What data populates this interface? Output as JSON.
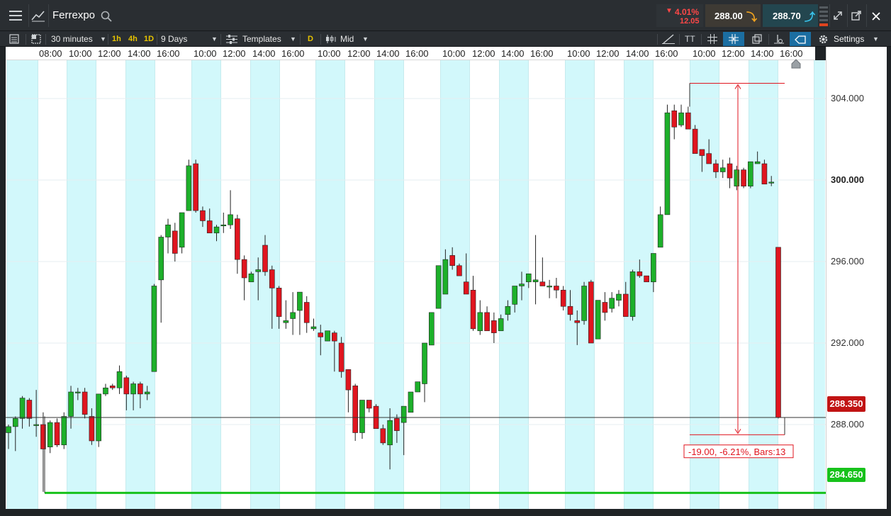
{
  "instrument": {
    "name": "Ferrexpo"
  },
  "quote": {
    "change_pct": "4.01%",
    "change_abs": "12.05",
    "sell": "288.00",
    "buy": "288.70"
  },
  "toolbar": {
    "interval": "30 minutes",
    "tf_1h": "1h",
    "tf_4h": "4h",
    "tf_1d": "1D",
    "range": "9 Days",
    "templates": "Templates",
    "d_badge": "D",
    "price_type": "Mid",
    "text_tool": "TT",
    "settings": "Settings"
  },
  "colors": {
    "up": "#1db02a",
    "down": "#e0151f",
    "band": "#d2f8fb",
    "level_line": "#17c21b",
    "current_tag": "#c11414"
  },
  "time_axis": {
    "labels": [
      "08:00",
      "10:00",
      "12:00",
      "14:00",
      "16:00",
      "10:00",
      "12:00",
      "14:00",
      "16:00",
      "10:00",
      "12:00",
      "14:00",
      "16:00",
      "10:00",
      "12:00",
      "14:00",
      "16:00",
      "10:00",
      "12:00",
      "14:00",
      "16:00",
      "10:00",
      "12:00",
      "14:00",
      "16:00"
    ]
  },
  "price_axis": {
    "labels": [
      "304.000",
      "300.000",
      "296.000",
      "292.000",
      "288.000"
    ],
    "current_price": "288.350",
    "level_price": "284.650"
  },
  "measure": {
    "label": "-19.00, -6.21%, Bars:13"
  },
  "chart_data": {
    "type": "candlestick",
    "title": "Ferrexpo",
    "interval": "30 minutes",
    "range": "9 Days",
    "ylim": [
      283.5,
      306.8
    ],
    "candles": [
      [
        287.6,
        288.0,
        286.8,
        287.9
      ],
      [
        287.9,
        288.4,
        286.7,
        288.3
      ],
      [
        288.3,
        289.4,
        287.8,
        289.3
      ],
      [
        289.2,
        289.3,
        287.9,
        288.3
      ],
      [
        288.0,
        289.7,
        287.4,
        288.0
      ],
      [
        288.0,
        288.6,
        284.7,
        286.8
      ],
      [
        286.9,
        288.2,
        286.6,
        288.1
      ],
      [
        288.1,
        288.3,
        286.9,
        287.0
      ],
      [
        287.0,
        288.6,
        286.8,
        288.4
      ],
      [
        288.4,
        289.9,
        287.8,
        289.6
      ],
      [
        289.6,
        289.8,
        289.2,
        289.6
      ],
      [
        289.6,
        289.8,
        288.3,
        288.5
      ],
      [
        288.4,
        288.8,
        287.0,
        287.2
      ],
      [
        287.2,
        289.5,
        286.9,
        289.5
      ],
      [
        289.5,
        290.0,
        289.4,
        289.8
      ],
      [
        289.9,
        290.0,
        289.7,
        289.8
      ],
      [
        289.8,
        290.9,
        289.5,
        290.6
      ],
      [
        290.3,
        290.4,
        288.7,
        289.5
      ],
      [
        289.5,
        290.1,
        288.7,
        290.0
      ],
      [
        290.0,
        290.1,
        288.8,
        289.5
      ],
      [
        289.5,
        289.9,
        289.2,
        289.6
      ],
      [
        290.6,
        294.9,
        290.6,
        294.8
      ],
      [
        295.1,
        297.3,
        293.0,
        297.2
      ],
      [
        297.2,
        298.1,
        296.4,
        297.8
      ],
      [
        297.5,
        297.9,
        296.0,
        296.4
      ],
      [
        296.7,
        298.4,
        296.4,
        298.4
      ],
      [
        298.5,
        301.0,
        298.5,
        300.7
      ],
      [
        300.8,
        301.0,
        298.4,
        298.5
      ],
      [
        298.5,
        298.7,
        297.7,
        298.0
      ],
      [
        298.0,
        298.6,
        297.5,
        297.4
      ],
      [
        297.4,
        297.8,
        297.0,
        297.7
      ],
      [
        297.8,
        298.4,
        297.4,
        297.8
      ],
      [
        297.8,
        299.5,
        297.6,
        298.3
      ],
      [
        298.1,
        298.3,
        295.4,
        296.1
      ],
      [
        296.1,
        296.3,
        294.1,
        295.2
      ],
      [
        295.0,
        295.5,
        295.0,
        295.4
      ],
      [
        295.5,
        296.2,
        294.1,
        295.6
      ],
      [
        296.8,
        297.3,
        295.3,
        295.5
      ],
      [
        295.6,
        295.8,
        292.7,
        294.7
      ],
      [
        294.7,
        294.8,
        292.7,
        293.3
      ],
      [
        293.0,
        294.1,
        292.7,
        293.1
      ],
      [
        293.2,
        294.5,
        292.4,
        293.5
      ],
      [
        293.6,
        294.5,
        292.4,
        294.5
      ],
      [
        294.0,
        294.3,
        292.5,
        293.0
      ],
      [
        292.7,
        293.2,
        292.6,
        292.8
      ],
      [
        292.5,
        292.9,
        291.4,
        292.3
      ],
      [
        292.1,
        292.6,
        292.1,
        292.6
      ],
      [
        292.5,
        292.6,
        290.6,
        292.1
      ],
      [
        292.0,
        292.3,
        290.3,
        290.6
      ],
      [
        290.7,
        290.7,
        288.6,
        289.7
      ],
      [
        289.9,
        290.0,
        287.2,
        287.6
      ],
      [
        287.6,
        287.8,
        287.3,
        289.2
      ],
      [
        289.2,
        289.2,
        288.6,
        288.8
      ],
      [
        288.9,
        289.0,
        287.9,
        287.8
      ],
      [
        287.8,
        288.0,
        287.0,
        287.1
      ],
      [
        287.0,
        288.8,
        285.8,
        288.2
      ],
      [
        288.3,
        288.5,
        287.1,
        287.7
      ],
      [
        288.1,
        288.8,
        286.5,
        288.9
      ],
      [
        288.6,
        289.6,
        288.6,
        289.6
      ],
      [
        289.6,
        290.0,
        290.0,
        290.1
      ],
      [
        290.0,
        292.0,
        289.1,
        292.0
      ],
      [
        291.9,
        293.5,
        291.9,
        293.5
      ],
      [
        293.7,
        294.6,
        293.7,
        295.8
      ],
      [
        294.4,
        296.6,
        294.4,
        296.1
      ],
      [
        296.3,
        296.7,
        295.6,
        295.8
      ],
      [
        295.8,
        295.9,
        295.6,
        295.3
      ],
      [
        295.0,
        296.4,
        294.5,
        294.4
      ],
      [
        294.6,
        295.3,
        292.6,
        292.7
      ],
      [
        292.6,
        294.1,
        292.4,
        293.5
      ],
      [
        293.5,
        293.8,
        292.6,
        292.6
      ],
      [
        293.1,
        293.5,
        292.0,
        292.5
      ],
      [
        292.6,
        293.4,
        292.6,
        293.2
      ],
      [
        293.4,
        294.1,
        293.1,
        293.8
      ],
      [
        293.9,
        294.2,
        293.5,
        294.8
      ],
      [
        294.8,
        295.5,
        294.1,
        294.9
      ],
      [
        295.0,
        295.2,
        294.7,
        295.4
      ],
      [
        295.0,
        297.3,
        293.9,
        295.1
      ],
      [
        295.0,
        296.2,
        294.8,
        294.8
      ],
      [
        294.8,
        295.1,
        294.2,
        294.8
      ],
      [
        294.8,
        295.2,
        294.2,
        294.6
      ],
      [
        294.6,
        294.8,
        293.6,
        293.8
      ],
      [
        293.8,
        294.6,
        293.1,
        293.4
      ],
      [
        293.1,
        293.6,
        291.9,
        293.0
      ],
      [
        293.1,
        295.0,
        292.9,
        294.8
      ],
      [
        295.0,
        295.1,
        292.1,
        292.0
      ],
      [
        292.2,
        294.1,
        292.2,
        294.1
      ],
      [
        294.0,
        294.5,
        293.1,
        293.5
      ],
      [
        293.7,
        294.5,
        293.5,
        294.2
      ],
      [
        294.1,
        294.6,
        293.8,
        294.4
      ],
      [
        294.4,
        295.0,
        293.7,
        293.3
      ],
      [
        293.3,
        295.6,
        293.1,
        295.5
      ],
      [
        295.5,
        296.1,
        295.2,
        295.3
      ],
      [
        295.3,
        295.3,
        295.0,
        295.0
      ],
      [
        295.0,
        296.4,
        294.5,
        296.4
      ],
      [
        296.7,
        298.7,
        296.7,
        298.3
      ],
      [
        298.3,
        303.7,
        298.3,
        303.3
      ],
      [
        303.4,
        303.7,
        302.0,
        302.6
      ],
      [
        302.7,
        303.7,
        302.6,
        303.3
      ],
      [
        303.3,
        303.6,
        302.8,
        302.5
      ],
      [
        302.5,
        302.7,
        301.3,
        301.3
      ],
      [
        301.5,
        301.5,
        300.4,
        301.2
      ],
      [
        301.3,
        302.0,
        300.8,
        300.8
      ],
      [
        300.8,
        301.0,
        300.1,
        300.4
      ],
      [
        300.4,
        301.0,
        300.1,
        300.6
      ],
      [
        300.8,
        301.1,
        299.6,
        300.1
      ],
      [
        299.7,
        300.7,
        299.5,
        300.5
      ],
      [
        300.5,
        300.6,
        299.6,
        299.7
      ],
      [
        299.7,
        300.8,
        299.6,
        300.9
      ],
      [
        300.8,
        301.4,
        300.9,
        300.9
      ],
      [
        300.8,
        301.0,
        299.8,
        299.8
      ],
      [
        299.9,
        300.2,
        299.7,
        299.9
      ],
      [
        296.7,
        296.7,
        288.3,
        288.35
      ]
    ],
    "sessions": 9,
    "current_price": 288.35,
    "support_level": 284.65,
    "measurement": {
      "high": 304.75,
      "low": 287.5,
      "change": -19.0,
      "change_pct": -6.21,
      "bars": 13
    }
  }
}
